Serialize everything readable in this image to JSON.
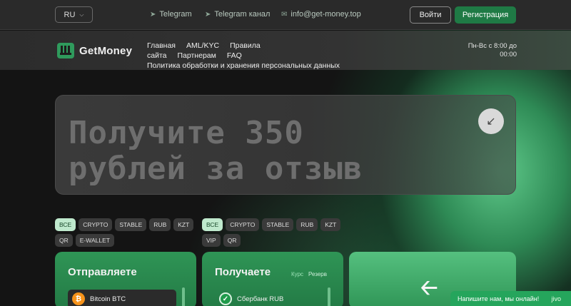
{
  "topbar": {
    "language": "RU",
    "telegram": "Telegram",
    "telegram_channel": "Telegram канал",
    "email": "info@get-money.top",
    "login": "Войти",
    "register": "Регистрация"
  },
  "header": {
    "logo": "GetMoney",
    "nav": [
      "Главная",
      "AML/KYC",
      "Правила сайта",
      "Партнерам",
      "FAQ",
      "Политика обработки и хранения персональных данных"
    ],
    "hours_line1": "Пн-Вс с 8:00 до",
    "hours_line2": "00:00"
  },
  "hero": {
    "title_line1": "Получите 350",
    "title_line2": "рублей за отзыв"
  },
  "send_filters": [
    "ВСЕ",
    "CRYPTO",
    "STABLE",
    "RUB",
    "KZT",
    "QR",
    "E-WALLET"
  ],
  "receive_filters": [
    "ВСЕ",
    "CRYPTO",
    "STABLE",
    "RUB",
    "KZT",
    "VIP",
    "QR"
  ],
  "send_card": {
    "title": "Отправляете",
    "item": "Bitcoin BTC"
  },
  "receive_card": {
    "title": "Получаете",
    "rate_label": "Курс",
    "reserve_label": "Резерв",
    "item": "Сбербанк RUB"
  },
  "chat": {
    "text": "Напишите нам, мы онлайн!",
    "brand": "jivo"
  },
  "colors": {
    "accent": "#1f7a45",
    "card": "#2f9556",
    "chip_active": "#bfe9cd"
  }
}
